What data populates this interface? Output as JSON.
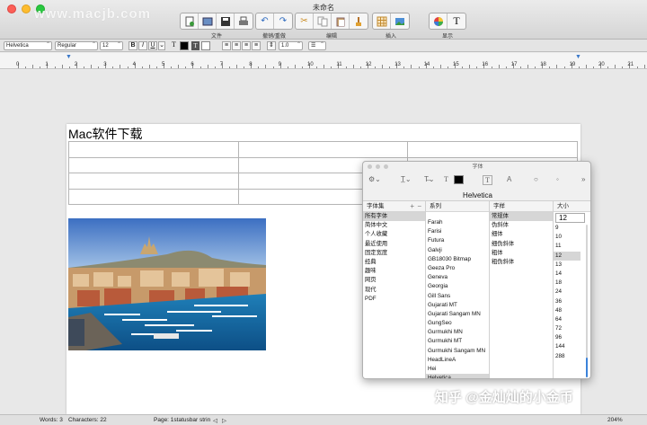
{
  "window": {
    "title": "未命名",
    "watermark_top": "www.macjb.com"
  },
  "toolbar": {
    "groups": [
      {
        "label": "文件",
        "icons": [
          "new-doc-icon",
          "open-icon",
          "save-icon",
          "print-icon"
        ]
      },
      {
        "label": "撤销/重做",
        "icons": [
          "undo-icon",
          "redo-icon"
        ]
      },
      {
        "label": "编辑",
        "icons": [
          "cut-icon",
          "copy-icon",
          "paste-icon",
          "format-brush-icon"
        ]
      },
      {
        "label": "插入",
        "icons": [
          "insert-table-icon",
          "insert-image-icon"
        ]
      },
      {
        "label": "显示",
        "icons": [
          "colors-icon",
          "fonts-icon"
        ]
      }
    ]
  },
  "formatbar": {
    "font_family": "Helvetica",
    "font_style": "Regular",
    "font_size": "12",
    "bold": "B",
    "italic": "I",
    "underline": "U",
    "line_spacing": "1.0",
    "text_color": "#000000"
  },
  "ruler": {
    "numbers": [
      "0",
      "1",
      "2",
      "3",
      "4",
      "5",
      "6",
      "7",
      "8",
      "9",
      "10",
      "11",
      "12",
      "13",
      "14",
      "15",
      "16",
      "17",
      "18",
      "19",
      "20",
      "21"
    ]
  },
  "document": {
    "heading": "Mac软件下载",
    "table": {
      "rows": 4,
      "cols": 3
    }
  },
  "font_panel": {
    "title": "字体",
    "current_font": "Helvetica",
    "collections_header": "字体集",
    "collections": [
      "所有字体",
      "简体中文",
      "个人收藏",
      "最近使用",
      "固定宽度",
      "经典",
      "趣味",
      "网页",
      "现代",
      "PDF"
    ],
    "collections_selected": 0,
    "family_header": "系列",
    "families": [
      "Farah",
      "Farisi",
      "Futura",
      "Galvji",
      "GB18030 Bitmap",
      "Geeza Pro",
      "Geneva",
      "Georgia",
      "Gill Sans",
      "Gujarati MT",
      "Gujarati Sangam MN",
      "GungSeo",
      "Gurmukhi MN",
      "Gurmukhi MT",
      "Gurmukhi Sangam MN",
      "HeadLineA",
      "Hei",
      "Helvetica"
    ],
    "families_selected": 17,
    "typeface_header": "字样",
    "typefaces": [
      "常规体",
      "伪斜体",
      "细体",
      "细伪斜体",
      "粗体",
      "粗伪斜体"
    ],
    "typefaces_selected": 0,
    "size_header": "大小",
    "size_value": "12",
    "sizes": [
      "9",
      "10",
      "11",
      "12",
      "13",
      "14",
      "18",
      "24",
      "36",
      "48",
      "64",
      "72",
      "96",
      "144",
      "288"
    ],
    "sizes_selected": 3
  },
  "statusbar": {
    "words": "Words: 3",
    "characters": "Characters: 22",
    "page": "Page: 1statusbar strin",
    "zoom": "204%"
  },
  "watermark_bottom": "知乎 @金灿灿的小金币"
}
